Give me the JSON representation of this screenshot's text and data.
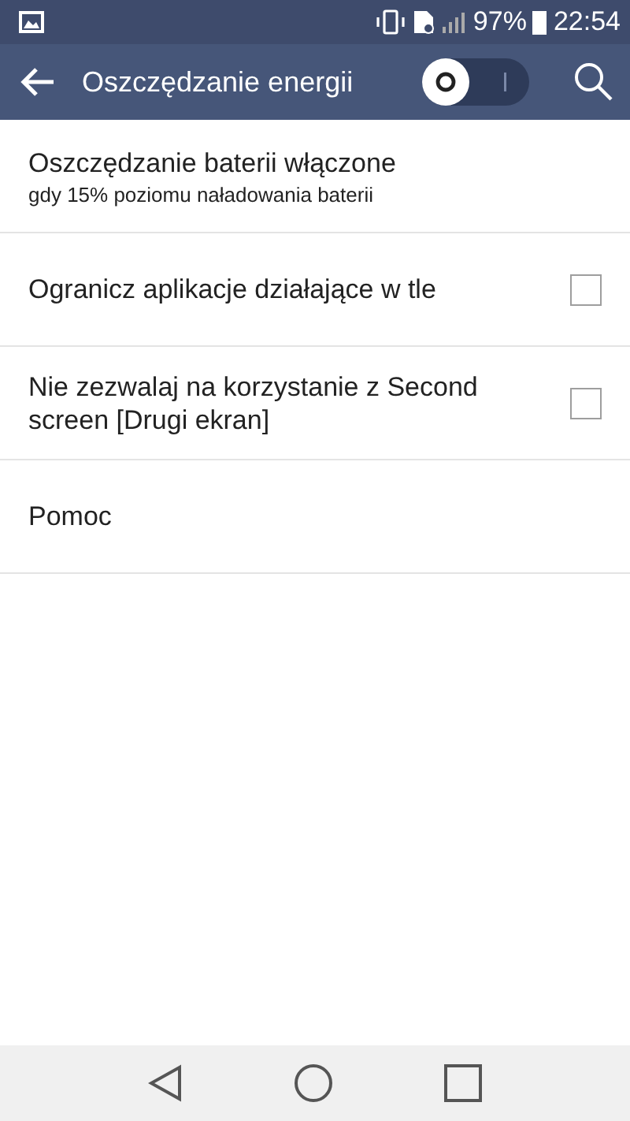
{
  "status_bar": {
    "battery": "97%",
    "time": "22:54"
  },
  "app_bar": {
    "title": "Oszczędzanie energii",
    "switch": {
      "on": false
    }
  },
  "items": [
    {
      "kind": "info",
      "title": "Oszczędzanie baterii włączone",
      "subtitle": "gdy 15% poziomu naładowania baterii"
    },
    {
      "kind": "checkbox",
      "title": "Ogranicz aplikacje działające w tle",
      "checked": false
    },
    {
      "kind": "checkbox",
      "title": "Nie zezwalaj na korzystanie z Second screen [Drugi ekran]",
      "checked": false
    },
    {
      "kind": "plain",
      "title": "Pomoc"
    }
  ]
}
